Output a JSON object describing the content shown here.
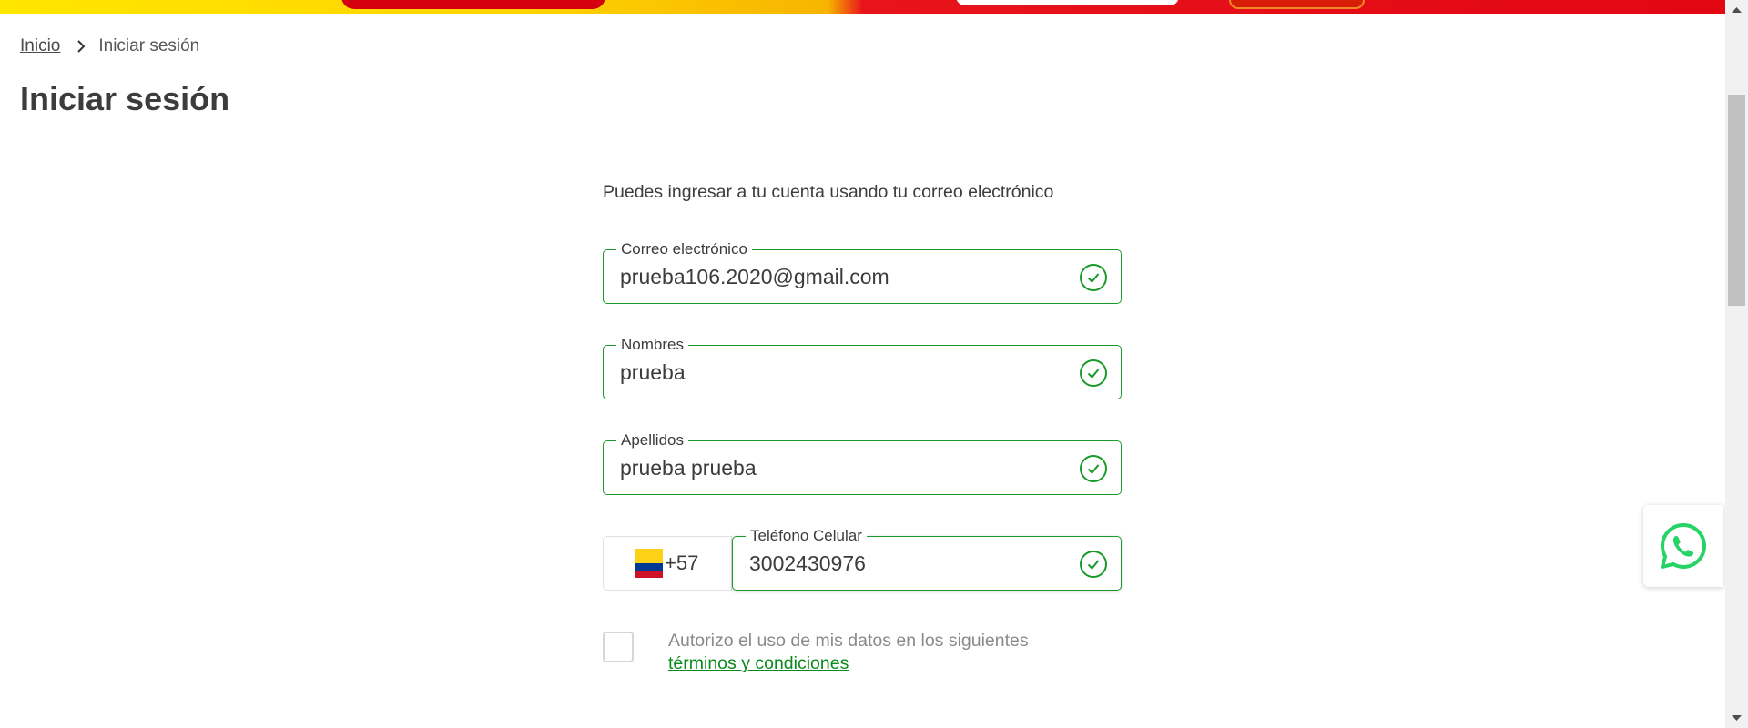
{
  "breadcrumb": {
    "home": "Inicio",
    "current": "Iniciar sesión"
  },
  "page": {
    "title": "Iniciar sesión"
  },
  "form": {
    "intro": "Puedes ingresar a tu cuenta usando tu correo electrónico",
    "email": {
      "label": "Correo electrónico",
      "value": "prueba106.2020@gmail.com"
    },
    "first_name": {
      "label": "Nombres",
      "value": "prueba"
    },
    "last_name": {
      "label": "Apellidos",
      "value": "prueba prueba"
    },
    "phone": {
      "prefix": "+57",
      "label": "Teléfono Celular",
      "value": "3002430976"
    },
    "consent": {
      "text": "Autorizo el uso de mis datos en los siguientes",
      "link": "términos y condiciones"
    }
  },
  "icons": {
    "valid": "check-circle-icon",
    "flag": "colombia-flag-icon",
    "whatsapp": "whatsapp-icon",
    "breadcrumb_separator": "chevron-right-icon"
  },
  "colors": {
    "accent": "#1a9a2a",
    "link": "#0a8a1c",
    "whatsapp": "#25d366"
  }
}
